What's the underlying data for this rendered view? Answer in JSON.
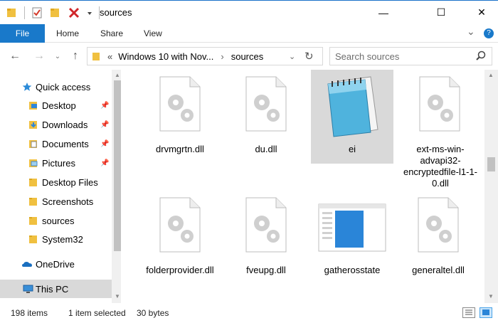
{
  "window": {
    "title": "sources",
    "minimize_glyph": "—",
    "maximize_glyph": "☐",
    "close_glyph": "✕"
  },
  "ribbon": {
    "file_label": "File",
    "tabs": [
      "Home",
      "Share",
      "View"
    ],
    "expand_glyph": "⌄",
    "help_glyph": "?"
  },
  "address": {
    "crumb_prefix": "«",
    "crumb_path": "Windows 10 with Nov...",
    "crumb_current": "sources",
    "search_placeholder": "Search sources"
  },
  "sidebar": {
    "items": [
      {
        "label": "Quick access",
        "icon": "star-icon"
      },
      {
        "label": "Desktop",
        "icon": "folder-blue-icon",
        "pinned": true
      },
      {
        "label": "Downloads",
        "icon": "download-folder-icon",
        "pinned": true
      },
      {
        "label": "Documents",
        "icon": "documents-folder-icon",
        "pinned": true
      },
      {
        "label": "Pictures",
        "icon": "pictures-folder-icon",
        "pinned": true
      },
      {
        "label": "Desktop Files",
        "icon": "folder-icon"
      },
      {
        "label": "Screenshots",
        "icon": "folder-icon"
      },
      {
        "label": "sources",
        "icon": "folder-icon"
      },
      {
        "label": "System32",
        "icon": "folder-icon"
      },
      {
        "label": "OneDrive",
        "icon": "onedrive-icon"
      },
      {
        "label": "This PC",
        "icon": "pc-icon"
      }
    ]
  },
  "files": [
    {
      "name": "drvmgrtn.dll",
      "type": "dll"
    },
    {
      "name": "du.dll",
      "type": "dll"
    },
    {
      "name": "ei",
      "type": "notepad"
    },
    {
      "name": "ext-ms-win-advapi32-encryptedfile-l1-1-0.dll",
      "type": "dll"
    },
    {
      "name": "folderprovider.dll",
      "type": "dll"
    },
    {
      "name": "fveupg.dll",
      "type": "dll"
    },
    {
      "name": "gatherosstate",
      "type": "app"
    },
    {
      "name": "generaltel.dll",
      "type": "dll"
    }
  ],
  "status": {
    "item_count": "198 items",
    "selected": "1 item selected",
    "size": "30 bytes"
  },
  "colors": {
    "accent": "#1979ca",
    "selection": "#d9d9d9",
    "folder": "#f5c242"
  }
}
